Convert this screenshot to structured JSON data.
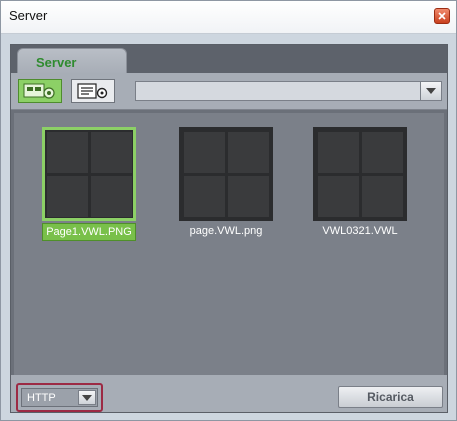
{
  "window": {
    "title": "Server"
  },
  "tabs": [
    {
      "label": "Server"
    }
  ],
  "toolbar": {
    "address_value": ""
  },
  "files": [
    {
      "name": "Page1.VWL.PNG",
      "selected": true
    },
    {
      "name": "page.VWL.png",
      "selected": false
    },
    {
      "name": "VWL0321.VWL",
      "selected": false
    }
  ],
  "footer": {
    "protocol_value": "HTTP",
    "reload_label": "Ricarica"
  },
  "colors": {
    "accent_green": "#79c04a",
    "highlight_border": "#9c2a44",
    "panel_bg": "#6b7079"
  }
}
